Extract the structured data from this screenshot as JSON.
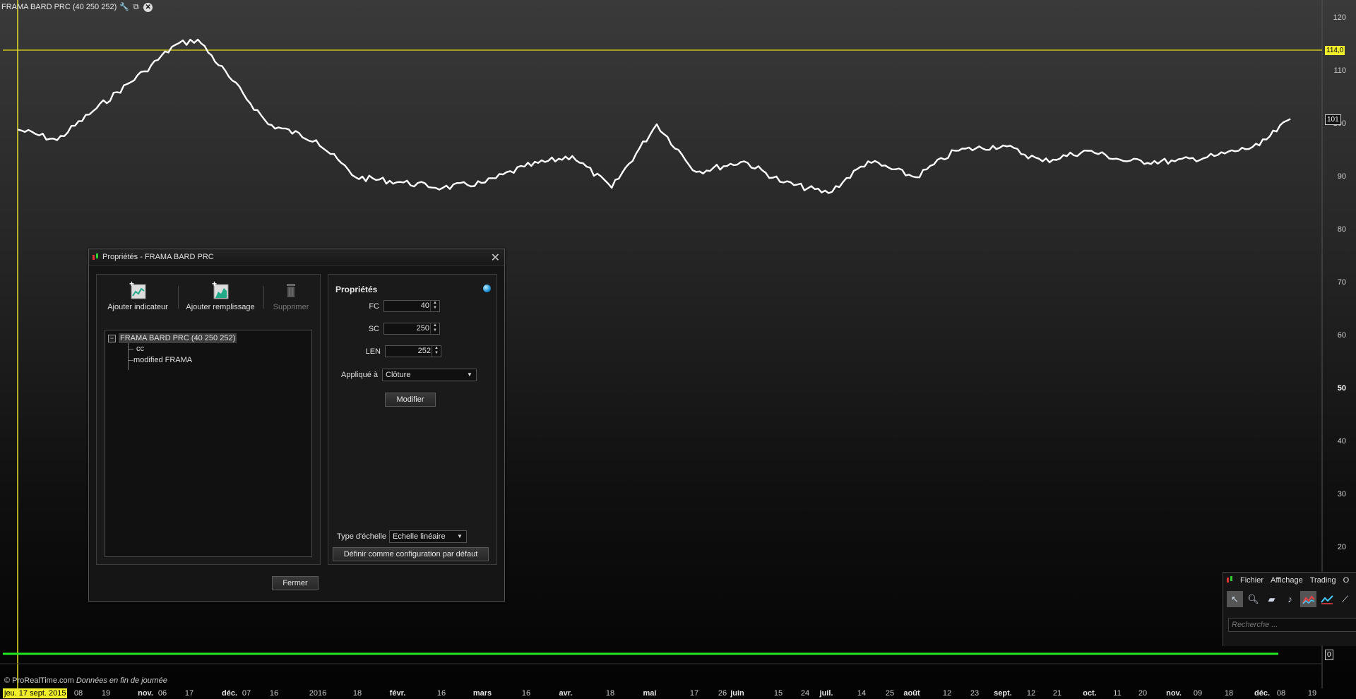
{
  "chart_title": "FRAMA  BARD PRC (40 250 252)",
  "price_axis": {
    "ticks": [
      "120",
      "110",
      "100",
      "90",
      "80",
      "70",
      "60",
      "50",
      "40",
      "30",
      "20"
    ],
    "hline_label": "114,0",
    "last_label": "101",
    "zero_label": "0"
  },
  "date_axis": {
    "start_label": "jeu. 17 sept. 2015",
    "labels": [
      "08",
      "19",
      "nov.",
      "06",
      "17",
      "déc.",
      "07",
      "16",
      "2016",
      "18",
      "févr.",
      "16",
      "mars",
      "16",
      "avr.",
      "18",
      "mai",
      "17",
      "26",
      "juin",
      "15",
      "24",
      "juil.",
      "14",
      "25",
      "août",
      "12",
      "23",
      "sept.",
      "12",
      "21",
      "oct.",
      "11",
      "20",
      "nov.",
      "09",
      "18",
      "déc.",
      "08",
      "19"
    ]
  },
  "footer": {
    "brand": "© ProRealTime.com",
    "note": "Données en fin de journée"
  },
  "colors": {
    "price_line": "#ffffff",
    "hline": "#c8c01e",
    "vline": "#e6e024",
    "zero_line": "#22e622",
    "accent_tag": "#f1ee2a"
  },
  "chart_data": {
    "type": "line",
    "title": "FRAMA  BARD PRC (40 250 252)",
    "xlabel": "",
    "ylabel": "",
    "x_range": [
      "2015-09-17",
      "2016-12-19"
    ],
    "ylim": [
      15,
      124
    ],
    "horizontal_line": 114.0,
    "lower_panel_value": 0,
    "x": [
      "2015-09-17",
      "2015-10-01",
      "2015-10-15",
      "2015-11-01",
      "2015-11-12",
      "2015-11-20",
      "2015-12-01",
      "2015-12-15",
      "2016-01-01",
      "2016-01-15",
      "2016-02-01",
      "2016-02-15",
      "2016-03-01",
      "2016-03-15",
      "2016-04-01",
      "2016-04-15",
      "2016-05-01",
      "2016-05-15",
      "2016-06-01",
      "2016-06-15",
      "2016-07-01",
      "2016-07-15",
      "2016-08-01",
      "2016-08-15",
      "2016-09-01",
      "2016-09-15",
      "2016-10-01",
      "2016-10-15",
      "2016-11-01",
      "2016-11-15",
      "2016-12-01",
      "2016-12-12"
    ],
    "values": [
      99,
      97,
      103,
      110,
      115,
      116,
      109,
      100,
      97,
      90,
      89,
      88,
      89,
      92,
      94,
      88,
      100,
      91,
      93,
      89,
      87,
      93,
      90,
      95,
      96,
      93,
      95,
      93,
      93,
      94,
      96,
      101
    ]
  },
  "dialog": {
    "title": "Propriétés - FRAMA  BARD PRC",
    "close_glyph": "✕",
    "toolbar": {
      "add_indicator": "Ajouter indicateur",
      "add_fill": "Ajouter remplissage",
      "delete": "Supprimer"
    },
    "tree": {
      "root": "FRAMA  BARD PRC (40 250 252)",
      "children": [
        "cc",
        "modified FRAMA"
      ]
    },
    "properties": {
      "heading": "Propriétés",
      "fc_label": "FC",
      "fc_value": "40",
      "sc_label": "SC",
      "sc_value": "250",
      "len_label": "LEN",
      "len_value": "252",
      "applied_label": "Appliqué à",
      "applied_value": "Clôture",
      "modify_button": "Modifier",
      "scale_label": "Type d'échelle",
      "scale_value": "Echelle linéaire",
      "default_button": "Définir comme configuration par défaut"
    },
    "close_button": "Fermer"
  },
  "mini_window": {
    "menu": [
      "Fichier",
      "Affichage",
      "Trading",
      "O"
    ],
    "tools": [
      "cursor-icon",
      "zoom-icon",
      "ruler-icon",
      "alert-bell-icon",
      "chart-icon",
      "indicator-icon",
      "drawing-line-icon"
    ],
    "search_placeholder": "Recherche ..."
  }
}
